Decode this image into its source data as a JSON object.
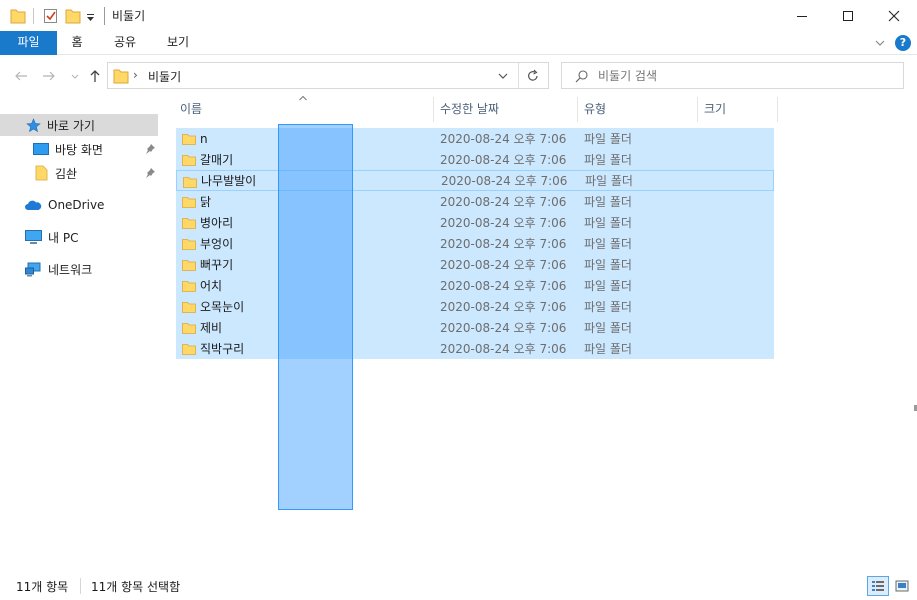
{
  "window": {
    "title": "비둘기",
    "icons": {
      "minimize": "minimize-icon",
      "maximize": "maximize-icon",
      "close": "close-icon"
    }
  },
  "ribbon": {
    "tabs": [
      {
        "label": "파일",
        "active": true
      },
      {
        "label": "홈"
      },
      {
        "label": "공유"
      },
      {
        "label": "보기"
      }
    ],
    "help": "?"
  },
  "address": {
    "crumb": "비둘기",
    "separator": "›"
  },
  "search": {
    "placeholder": "비둘기 검색"
  },
  "nav": {
    "items": [
      {
        "label": "바로 가기",
        "icon": "star-icon",
        "selected": true
      },
      {
        "label": "바탕 화면",
        "icon": "desktop-icon",
        "pinned": true
      },
      {
        "label": "김솬",
        "icon": "folder-icon",
        "pinned": true
      },
      {
        "label": "OneDrive",
        "icon": "cloud-icon"
      },
      {
        "label": "내 PC",
        "icon": "computer-icon"
      },
      {
        "label": "네트워크",
        "icon": "network-icon"
      }
    ]
  },
  "columns": {
    "name": "이름",
    "date": "수정한 날짜",
    "type": "유형",
    "size": "크기"
  },
  "files": [
    {
      "name": "n",
      "date": "2020-08-24 오후 7:06",
      "type": "파일 폴더"
    },
    {
      "name": "갈매기",
      "date": "2020-08-24 오후 7:06",
      "type": "파일 폴더"
    },
    {
      "name": "나무발발이",
      "date": "2020-08-24 오후 7:06",
      "type": "파일 폴더"
    },
    {
      "name": "닭",
      "date": "2020-08-24 오후 7:06",
      "type": "파일 폴더"
    },
    {
      "name": "병아리",
      "date": "2020-08-24 오후 7:06",
      "type": "파일 폴더"
    },
    {
      "name": "부엉이",
      "date": "2020-08-24 오후 7:06",
      "type": "파일 폴더"
    },
    {
      "name": "뻐꾸기",
      "date": "2020-08-24 오후 7:06",
      "type": "파일 폴더"
    },
    {
      "name": "어치",
      "date": "2020-08-24 오후 7:06",
      "type": "파일 폴더"
    },
    {
      "name": "오목눈이",
      "date": "2020-08-24 오후 7:06",
      "type": "파일 폴더"
    },
    {
      "name": "제비",
      "date": "2020-08-24 오후 7:06",
      "type": "파일 폴더"
    },
    {
      "name": "직박구리",
      "date": "2020-08-24 오후 7:06",
      "type": "파일 폴더"
    }
  ],
  "status": {
    "count": "11개 항목",
    "selected": "11개 항목 선택함"
  },
  "colors": {
    "accent": "#1979ca",
    "selection": "#cce8ff",
    "folder": "#ffd867"
  }
}
